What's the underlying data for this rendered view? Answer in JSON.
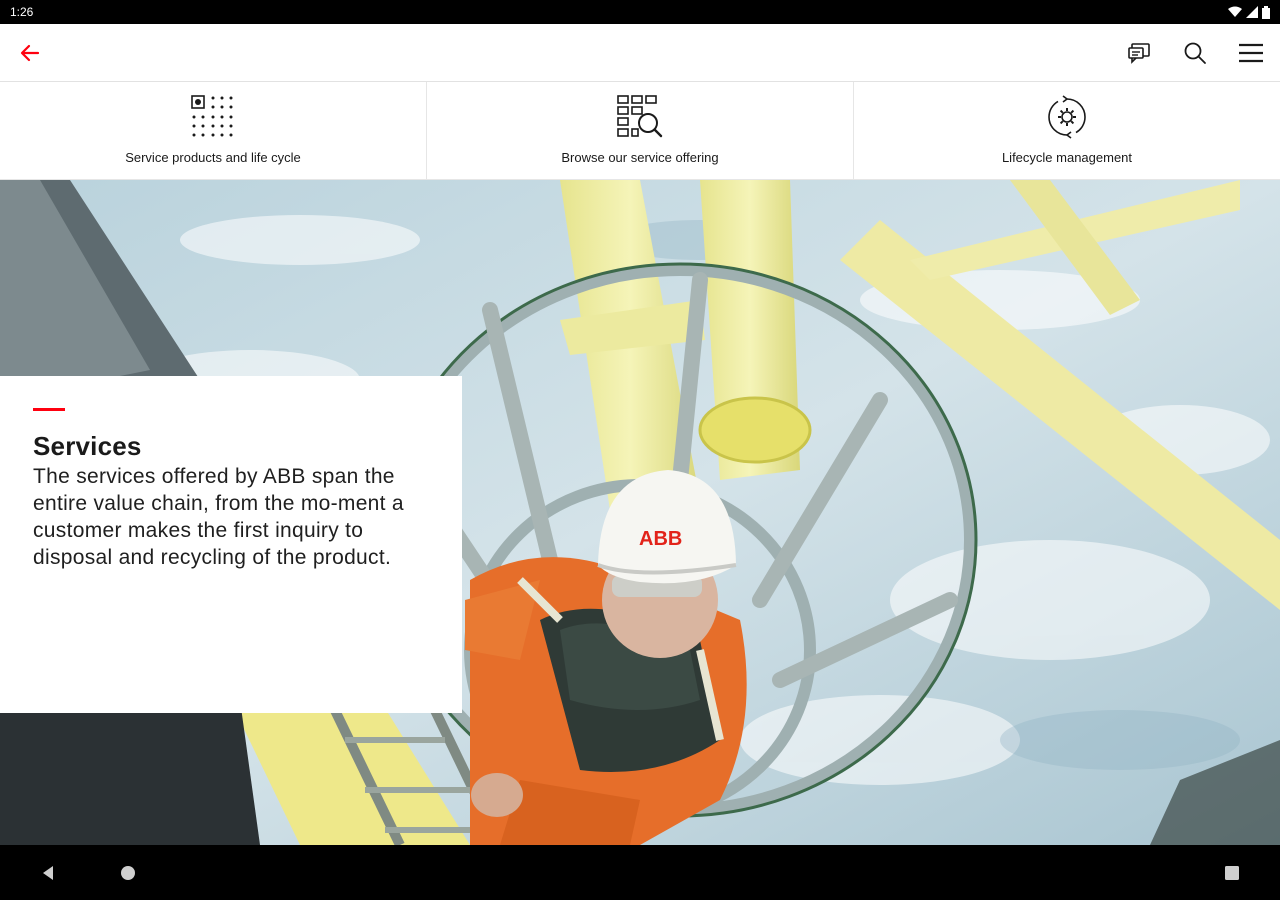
{
  "status_bar": {
    "time": "1:26",
    "icons": [
      "wifi-icon",
      "signal-icon",
      "battery-icon"
    ]
  },
  "app_bar": {
    "back_icon": "arrow-left-icon",
    "accent_color": "#ff000f",
    "actions": [
      {
        "name": "feedback",
        "icon": "feedback-icon"
      },
      {
        "name": "search",
        "icon": "search-icon"
      },
      {
        "name": "menu",
        "icon": "hamburger-menu-icon"
      }
    ]
  },
  "tabs": [
    {
      "label": "Service products and life cycle",
      "icon": "grid-focus-icon"
    },
    {
      "label": "Browse our service offering",
      "icon": "grid-search-icon"
    },
    {
      "label": "Lifecycle management",
      "icon": "lifecycle-gear-icon"
    }
  ],
  "hero": {
    "image": "offshore-worker-ladder-photo",
    "helmet_text": "ABB"
  },
  "card": {
    "title": "Services",
    "body": "The services offered by ABB span the entire value chain, from the mo-ment a customer makes the first inquiry to disposal and recycling of the product."
  },
  "nav_bar": {
    "buttons": [
      "back-triangle-icon",
      "home-circle-icon",
      "recents-square-icon"
    ]
  }
}
